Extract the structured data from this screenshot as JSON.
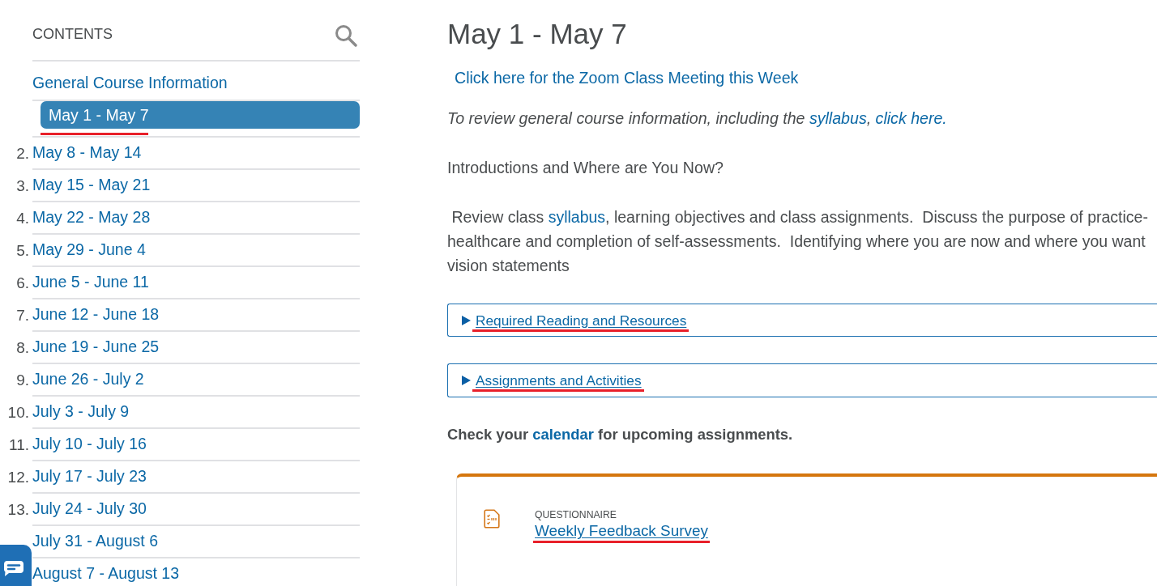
{
  "sidebar": {
    "heading": "CONTENTS",
    "items": [
      {
        "label": "General Course Information",
        "selected": false,
        "marked": false
      },
      {
        "label": "May 1 - May 7",
        "selected": true,
        "marked": true
      },
      {
        "number": "2.",
        "label": "May 8 - May 14",
        "selected": false,
        "marked": false
      },
      {
        "number": "3.",
        "label": "May 15 - May 21",
        "selected": false,
        "marked": false
      },
      {
        "number": "4.",
        "label": "May 22 - May 28",
        "selected": false,
        "marked": false
      },
      {
        "number": "5.",
        "label": "May 29 - June 4",
        "selected": false,
        "marked": false
      },
      {
        "number": "6.",
        "label": "June 5 - June 11",
        "selected": false,
        "marked": false
      },
      {
        "number": "7.",
        "label": "June 12 - June 18",
        "selected": false,
        "marked": false
      },
      {
        "number": "8.",
        "label": "June 19 - June 25",
        "selected": false,
        "marked": false
      },
      {
        "number": "9.",
        "label": "June 26 - July 2",
        "selected": false,
        "marked": false
      },
      {
        "number": "10.",
        "label": "July 3 - July 9",
        "selected": false,
        "marked": false
      },
      {
        "number": "11.",
        "label": "July 10 - July 16",
        "selected": false,
        "marked": false
      },
      {
        "number": "12.",
        "label": "July 17 - July 23",
        "selected": false,
        "marked": false
      },
      {
        "number": "13.",
        "label": "July 24 - July 30",
        "selected": false,
        "marked": false
      },
      {
        "label": "July 31 - August 6",
        "selected": false,
        "marked": false
      },
      {
        "label": "August 7 - August 13",
        "selected": false,
        "marked": false
      }
    ]
  },
  "main": {
    "title": "May 1 - May 7",
    "zoom_link": "Click here for the Zoom Class Meeting this Week",
    "review_note": [
      {
        "kind": "text",
        "text": "To review general course information, including the "
      },
      {
        "kind": "link",
        "text": "syllabus"
      },
      {
        "kind": "text",
        "text": ", "
      },
      {
        "kind": "link",
        "text": "click here."
      }
    ],
    "intro": "Introductions and Where are You Now?",
    "description_lines": [
      [
        {
          "kind": "text",
          "text": " Review class "
        },
        {
          "kind": "link",
          "text": "syllabus"
        },
        {
          "kind": "text",
          "text": ", learning objectives and class assignments.  Discuss the purpose of practice-"
        }
      ],
      [
        {
          "kind": "text",
          "text": "healthcare and completion of self-assessments.  Identifying where you are now and where you want"
        }
      ],
      [
        {
          "kind": "text",
          "text": "vision statements"
        }
      ]
    ],
    "sections": [
      {
        "label": "Required Reading and Resources",
        "expanded": false,
        "marked": true
      },
      {
        "label": "Assignments and Activities",
        "expanded": false,
        "marked": true
      }
    ],
    "calendar_note": [
      {
        "kind": "text",
        "text": "Check your "
      },
      {
        "kind": "link",
        "text": "calendar"
      },
      {
        "kind": "text",
        "text": " for upcoming assignments."
      }
    ],
    "activity_card": {
      "type_label": "QUESTIONNAIRE",
      "title": "Weekly Feedback Survey",
      "marked": true
    }
  }
}
